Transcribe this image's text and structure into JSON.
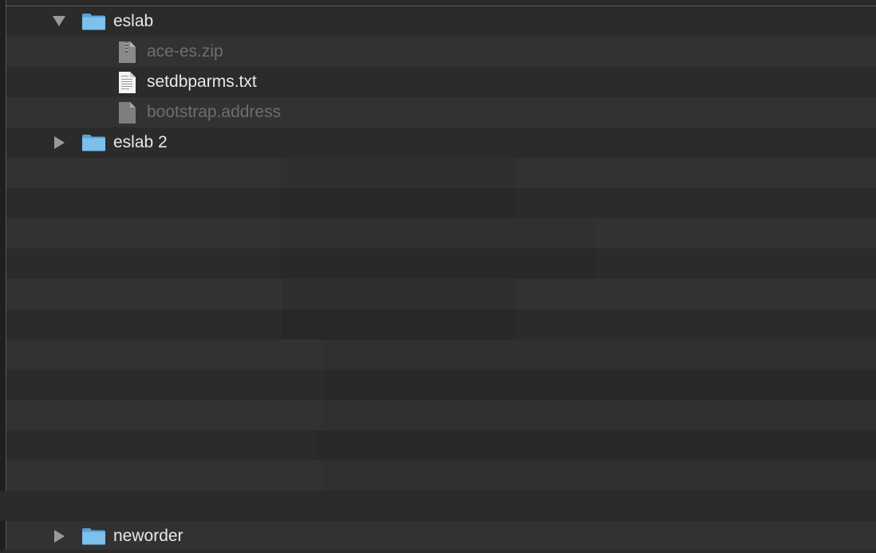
{
  "tree": {
    "items": [
      {
        "name": "eslab",
        "kind": "folder",
        "expanded": true,
        "dimmed": false
      },
      {
        "name": "ace-es.zip",
        "kind": "zip",
        "dimmed": true
      },
      {
        "name": "setdbparms.txt",
        "kind": "text",
        "dimmed": false
      },
      {
        "name": "bootstrap.address",
        "kind": "generic",
        "dimmed": true
      },
      {
        "name": "eslab 2",
        "kind": "folder",
        "expanded": false,
        "dimmed": false
      },
      {
        "name": "neworder",
        "kind": "folder",
        "expanded": false,
        "dimmed": false
      }
    ]
  },
  "colors": {
    "folder": "#72b7e6",
    "folder_tab": "#5aa3d6",
    "row_even": "#2b2b2b",
    "row_odd": "#323232",
    "text": "#e8e8e8",
    "text_dim": "#6e6e6e"
  }
}
